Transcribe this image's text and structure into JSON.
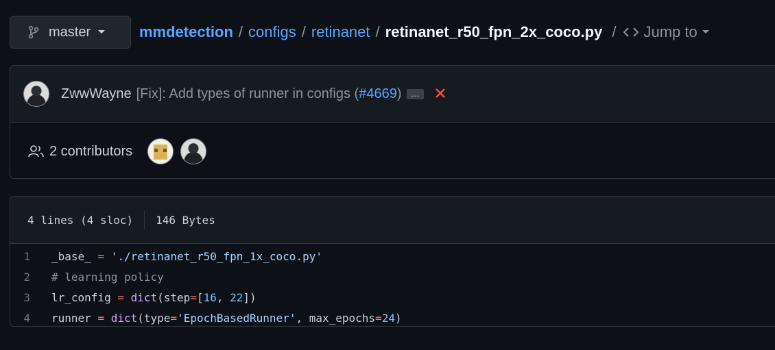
{
  "branch": {
    "label": "master"
  },
  "breadcrumb": {
    "repo": "mmdetection",
    "sep": "/",
    "folder1": "configs",
    "folder2": "retinanet",
    "file": "retinanet_r50_fpn_2x_coco.py",
    "jump_label": "Jump to"
  },
  "commit": {
    "author": "ZwwWayne",
    "message_prefix": "[Fix]: Add types of runner in configs (",
    "pr_link": "#4669",
    "message_suffix": ")",
    "ellipsis": "…"
  },
  "contributors": {
    "label": "2 contributors"
  },
  "file_info": {
    "lines": "4 lines (4 sloc)",
    "size": "146 Bytes"
  },
  "code": {
    "lines": [
      {
        "num": "1",
        "tokens": [
          {
            "t": "_base_ ",
            "c": "default"
          },
          {
            "t": "=",
            "c": "op"
          },
          {
            "t": " ",
            "c": "default"
          },
          {
            "t": "'./retinanet_r50_fpn_1x_coco.py'",
            "c": "str"
          }
        ]
      },
      {
        "num": "2",
        "tokens": [
          {
            "t": "# learning policy",
            "c": "comment"
          }
        ]
      },
      {
        "num": "3",
        "tokens": [
          {
            "t": "lr_config ",
            "c": "default"
          },
          {
            "t": "=",
            "c": "op"
          },
          {
            "t": " ",
            "c": "default"
          },
          {
            "t": "dict",
            "c": "builtin"
          },
          {
            "t": "(step",
            "c": "default"
          },
          {
            "t": "=",
            "c": "op"
          },
          {
            "t": "[",
            "c": "default"
          },
          {
            "t": "16",
            "c": "num"
          },
          {
            "t": ", ",
            "c": "default"
          },
          {
            "t": "22",
            "c": "num"
          },
          {
            "t": "])",
            "c": "default"
          }
        ]
      },
      {
        "num": "4",
        "tokens": [
          {
            "t": "runner ",
            "c": "default"
          },
          {
            "t": "=",
            "c": "op"
          },
          {
            "t": " ",
            "c": "default"
          },
          {
            "t": "dict",
            "c": "builtin"
          },
          {
            "t": "(type",
            "c": "default"
          },
          {
            "t": "=",
            "c": "op"
          },
          {
            "t": "'EpochBasedRunner'",
            "c": "str"
          },
          {
            "t": ", max_epochs",
            "c": "default"
          },
          {
            "t": "=",
            "c": "op"
          },
          {
            "t": "24",
            "c": "num"
          },
          {
            "t": ")",
            "c": "default"
          }
        ]
      }
    ]
  },
  "colors": {
    "background": "#0d1117",
    "link": "#58a6ff",
    "error": "#f85149"
  },
  "icons": [
    "git-branch-icon",
    "chevron-down-icon",
    "code-icon",
    "people-icon",
    "close-icon"
  ]
}
